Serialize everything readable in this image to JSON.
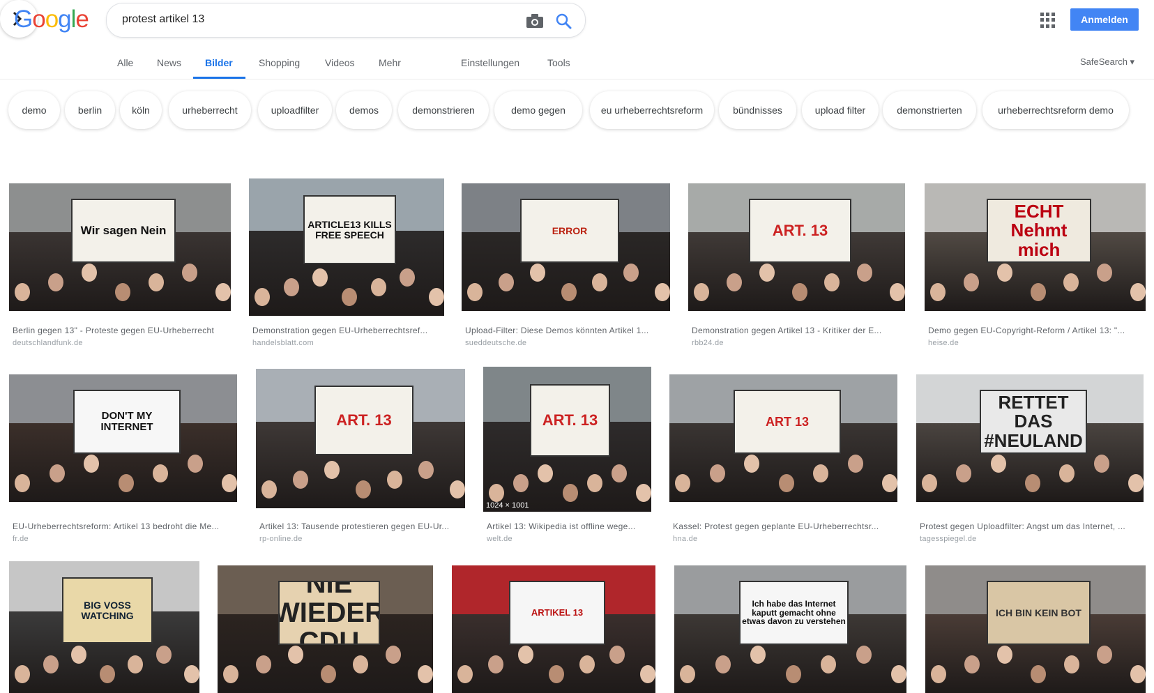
{
  "header": {
    "logo_text": "Google",
    "search_value": "protest artikel 13",
    "signin_label": "Anmelden"
  },
  "tabs": {
    "alle": "Alle",
    "news": "News",
    "bilder": "Bilder",
    "shopping": "Shopping",
    "videos": "Videos",
    "mehr": "Mehr",
    "einstellungen": "Einstellungen",
    "tools": "Tools",
    "safesearch": "SafeSearch ▾"
  },
  "chips": [
    "demo",
    "berlin",
    "köln",
    "urheberrecht",
    "uploadfilter",
    "demos",
    "demonstrieren",
    "demo gegen",
    "eu urheberrechtsreform",
    "bündnisses",
    "upload filter",
    "demonstrierten",
    "urheberrechtsreform demo"
  ],
  "results": [
    {
      "caption": "Berlin gegen 13\" - Proteste gegen EU-Urheberrecht",
      "source": "deutschlandfunk.de",
      "sign": "Wir sagen Nein"
    },
    {
      "caption": "Demonstration gegen EU-Urheberrechtsref...",
      "source": "handelsblatt.com",
      "sign": "ARTICLE13 KILLS FREE SPEECH"
    },
    {
      "caption": "Upload-Filter: Diese Demos könnten Artikel 1...",
      "source": "sueddeutsche.de",
      "sign": "ERROR"
    },
    {
      "caption": "Demonstration gegen Artikel 13 - Kritiker der E...",
      "source": "rbb24.de",
      "sign": "ART. 13"
    },
    {
      "caption": "Demo gegen EU-Copyright-Reform / Artikel 13: \"...",
      "source": "heise.de",
      "sign": "Ich bin ECHT Nehmt mich ERNST"
    },
    {
      "caption": "EU-Urheberrechtsreform: Artikel 13 bedroht die Me...",
      "source": "fr.de",
      "sign": "DON'T MY INTERNET"
    },
    {
      "caption": "Artikel 13: Tausende protestieren gegen EU-Ur...",
      "source": "rp-online.de",
      "sign": "ART. 13"
    },
    {
      "caption": "Artikel 13: Wikipedia ist offline wege...",
      "source": "welt.de",
      "sign": "ART. 13",
      "dimensions": "1024 × 1001"
    },
    {
      "caption": "Kassel: Protest gegen geplante EU-Urheberrechtsr...",
      "source": "hna.de",
      "sign": "ART 13"
    },
    {
      "caption": "Protest gegen Uploadfilter: Angst um das Internet, ...",
      "source": "tagesspiegel.de",
      "sign": "RETTET DAS #NEULAND"
    },
    {
      "caption": "",
      "source": "",
      "sign": "BIG VOSS WATCHING"
    },
    {
      "caption": "",
      "source": "",
      "sign": "NIE WIEDER CDU"
    },
    {
      "caption": "",
      "source": "",
      "sign": "ARTIKEL 13"
    },
    {
      "caption": "",
      "source": "",
      "sign": "Ich habe das Internet kaputt gemacht ohne etwas davon zu verstehen"
    },
    {
      "caption": "",
      "source": "",
      "sign": "ICH BIN KEIN BOT"
    }
  ]
}
